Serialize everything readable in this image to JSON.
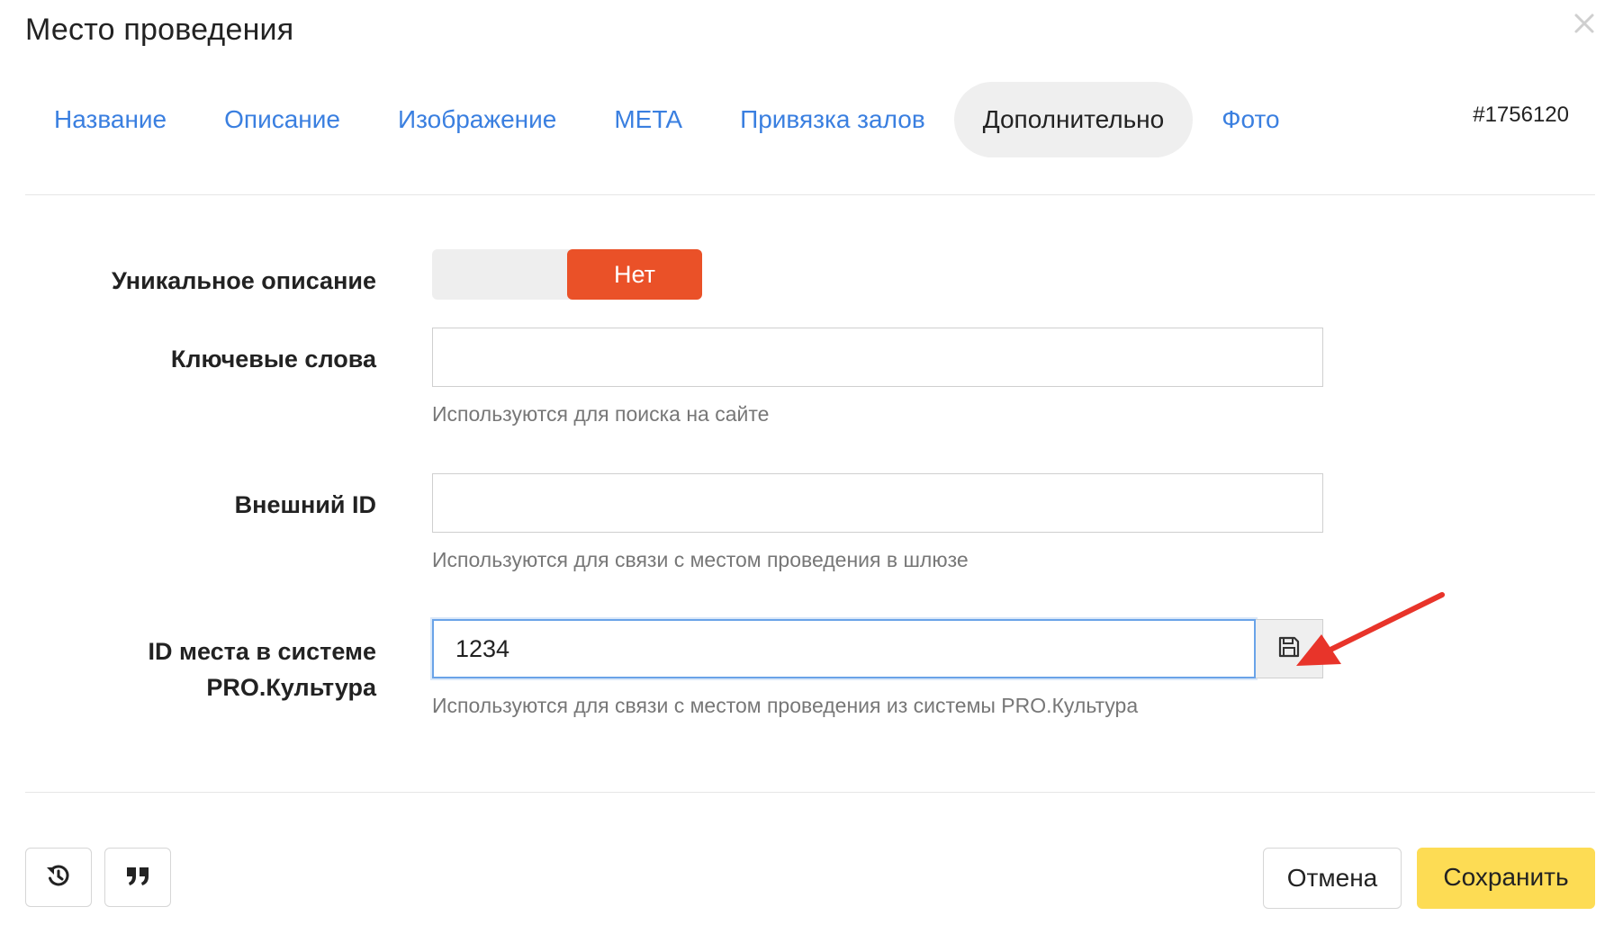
{
  "dialog": {
    "title": "Место проведения",
    "record_id": "#1756120"
  },
  "tabs": [
    {
      "label": "Название",
      "active": false
    },
    {
      "label": "Описание",
      "active": false
    },
    {
      "label": "Изображение",
      "active": false
    },
    {
      "label": "META",
      "active": false
    },
    {
      "label": "Привязка залов",
      "active": false
    },
    {
      "label": "Дополнительно",
      "active": true
    },
    {
      "label": "Фото",
      "active": false
    }
  ],
  "form": {
    "unique_description": {
      "label": "Уникальное описание",
      "value": "Нет"
    },
    "keywords": {
      "label": "Ключевые слова",
      "value": "",
      "hint": "Используются для поиска на сайте"
    },
    "external_id": {
      "label": "Внешний ID",
      "value": "",
      "hint": "Используются для связи с местом проведения в шлюзе"
    },
    "pro_culture_id": {
      "label_line1": "ID места в системе",
      "label_line2": "PRO.Культура",
      "value": "1234",
      "hint": "Используются для связи с местом проведения из системы PRO.Культура",
      "save_icon": "floppy-disk-icon"
    }
  },
  "footer": {
    "history_icon": "history-icon",
    "quote_icon": "quote-icon",
    "cancel_label": "Отмена",
    "save_label": "Сохранить"
  },
  "colors": {
    "link": "#3a7fe0",
    "active_tab_bg": "#efefef",
    "toggle_active": "#ea5128",
    "save_button": "#fddc54",
    "annotation_arrow": "#e8342a",
    "focus_border": "#6aa3e8"
  }
}
